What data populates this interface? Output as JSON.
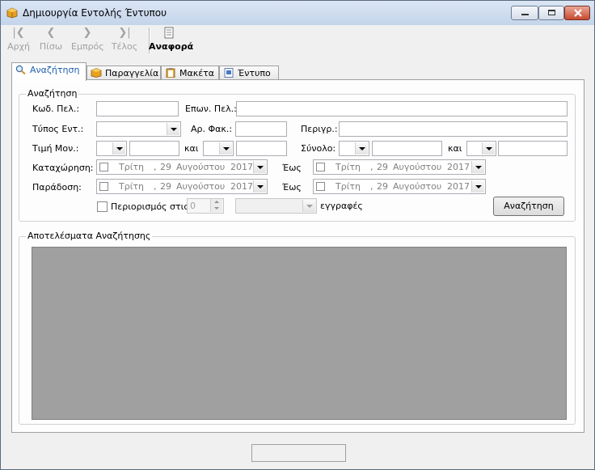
{
  "window": {
    "title": "Δημιουργία Εντολής Έντυπου"
  },
  "toolbar": {
    "first": "Αρχή",
    "prev": "Πίσω",
    "next": "Εμπρός",
    "last": "Τέλος",
    "report": "Αναφορά"
  },
  "tabs": [
    {
      "label": "Αναζήτηση",
      "icon": "magnifier-icon",
      "active": true
    },
    {
      "label": "Παραγγελία",
      "icon": "package-icon",
      "active": false
    },
    {
      "label": "Μακέτα",
      "icon": "clipboard-icon",
      "active": false
    },
    {
      "label": "Έντυπο",
      "icon": "document-icon",
      "active": false
    }
  ],
  "search": {
    "group_title": "Αναζήτηση",
    "customer_code_label": "Κωδ. Πελ.:",
    "customer_name_label": "Επων. Πελ.:",
    "order_type_label": "Τύπος Εντ.:",
    "folder_no_label": "Αρ. Φακ.:",
    "description_label": "Περιγρ.:",
    "unit_price_label": "Τιμή Μον.:",
    "and_label": "και",
    "total_label": "Σύνολο:",
    "registration_label": "Καταχώρηση:",
    "delivery_label": "Παράδοση:",
    "to_label": "Έως",
    "date": {
      "dow": "Τρίτη",
      "day": "29",
      "month": "Αυγούστου",
      "year": "2017"
    },
    "limit_label": "Περιορισμός στις",
    "limit_value": "0",
    "records_label": "εγγραφές",
    "search_button": "Αναζήτηση"
  },
  "results": {
    "group_title": "Αποτελέσματα Αναζήτησης"
  }
}
